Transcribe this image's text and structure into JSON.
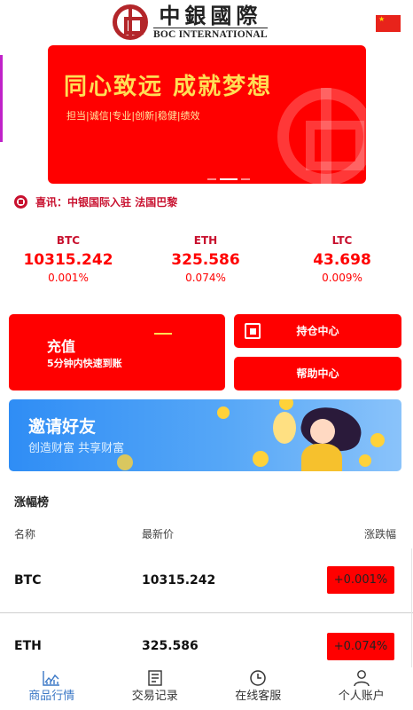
{
  "header": {
    "logo_cn": "中銀國際",
    "logo_en": "BOC INTERNATIONAL",
    "flag_star": "★"
  },
  "banner": {
    "title": "同心致远  成就梦想",
    "subtitle": "担当|诚信|专业|创新|稳健|绩效",
    "slide_count": 3,
    "active_slide": 2
  },
  "news": {
    "label": "喜讯：",
    "text": "中银国际入驻 法国巴黎"
  },
  "tickers": [
    {
      "symbol": "BTC",
      "price": "10315.242",
      "change": "0.001%"
    },
    {
      "symbol": "ETH",
      "price": "325.586",
      "change": "0.074%"
    },
    {
      "symbol": "LTC",
      "price": "43.698",
      "change": "0.009%"
    }
  ],
  "actions": {
    "recharge_title": "充值",
    "recharge_sub": "5分钟内快速到账",
    "position_center": "持仓中心",
    "help_center": "帮助中心"
  },
  "invite": {
    "title": "邀请好友",
    "subtitle": "创造财富 共享财富"
  },
  "ranking": {
    "title": "涨幅榜",
    "columns": [
      "名称",
      "最新价",
      "涨跌幅"
    ],
    "rows": [
      {
        "name": "BTC",
        "price": "10315.242",
        "change": "+0.001%"
      },
      {
        "name": "ETH",
        "price": "325.586",
        "change": "+0.074%"
      }
    ]
  },
  "tabs": [
    {
      "label": "商品行情",
      "icon": "chart-icon",
      "active": true
    },
    {
      "label": "交易记录",
      "icon": "document-icon",
      "active": false
    },
    {
      "label": "在线客服",
      "icon": "clock-icon",
      "active": false
    },
    {
      "label": "个人账户",
      "icon": "user-icon",
      "active": false
    }
  ],
  "colors": {
    "primary_red": "#ff0000",
    "brand_red": "#b3262a",
    "news_red": "#c8102e",
    "active_tab": "#3b78c6",
    "invite_blue": "#2f8df5"
  }
}
